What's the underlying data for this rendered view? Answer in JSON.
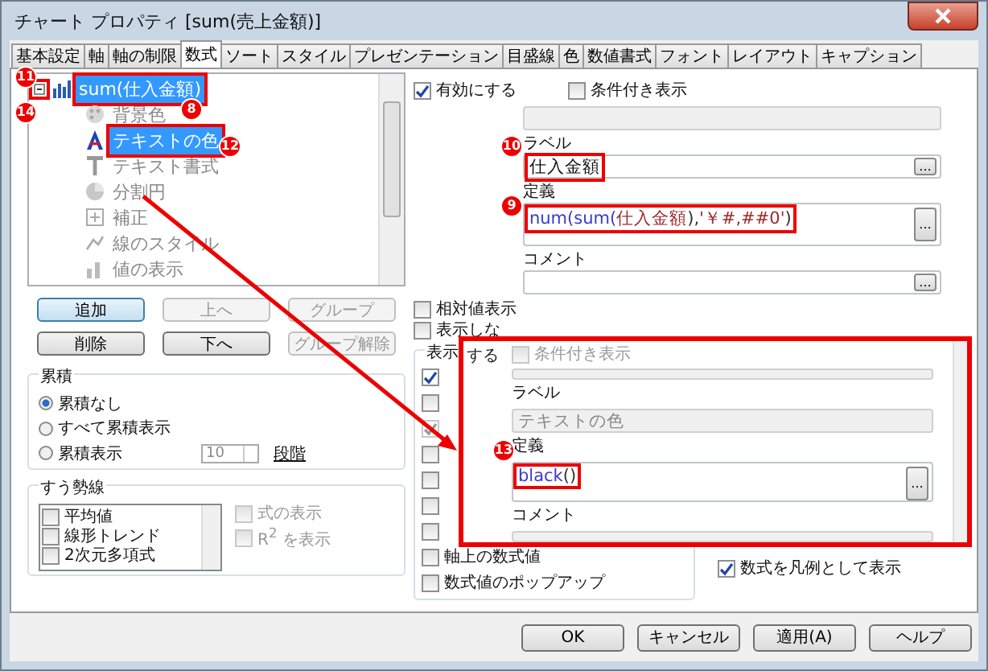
{
  "window": {
    "title": "チャート プロパティ [sum(売上金額)]"
  },
  "tabs": [
    {
      "label": "基本設定",
      "selected": false
    },
    {
      "label": "軸",
      "selected": false
    },
    {
      "label": "軸の制限",
      "selected": false
    },
    {
      "label": "数式",
      "selected": true
    },
    {
      "label": "ソート",
      "selected": false
    },
    {
      "label": "スタイル",
      "selected": false
    },
    {
      "label": "プレゼンテーション",
      "selected": false
    },
    {
      "label": "目盛線",
      "selected": false
    },
    {
      "label": "色",
      "selected": false
    },
    {
      "label": "数値書式",
      "selected": false
    },
    {
      "label": "フォント",
      "selected": false
    },
    {
      "label": "レイアウト",
      "selected": false
    },
    {
      "label": "キャプション",
      "selected": false
    }
  ],
  "tree": [
    {
      "label": "sum(仕入金額)",
      "kind": "bar",
      "selected": true,
      "annotated": true,
      "expander_annotated": true,
      "children": [
        {
          "label": "背景色",
          "kind": "palette",
          "selected": false,
          "dimmed": true,
          "annotated": false
        },
        {
          "label": "テキストの色",
          "kind": "text-color",
          "selected": true,
          "dimmed": false,
          "annotated": true
        },
        {
          "label": "テキスト書式",
          "kind": "text-format",
          "selected": false,
          "dimmed": true,
          "annotated": false
        },
        {
          "label": "分割円",
          "kind": "pie",
          "selected": false,
          "dimmed": true,
          "annotated": false
        },
        {
          "label": "補正",
          "kind": "adjust",
          "selected": false,
          "dimmed": true,
          "annotated": false
        },
        {
          "label": "線のスタイル",
          "kind": "line",
          "selected": false,
          "dimmed": true,
          "annotated": false
        },
        {
          "label": "値の表示",
          "kind": "value",
          "selected": false,
          "dimmed": true,
          "annotated": false
        }
      ]
    }
  ],
  "list_buttons": [
    {
      "label": "追加",
      "disabled": false,
      "default": true
    },
    {
      "label": "上へ",
      "disabled": true,
      "default": false
    },
    {
      "label": "グループ",
      "disabled": true,
      "default": false
    },
    {
      "label": "削除",
      "disabled": false,
      "default": false
    },
    {
      "label": "下へ",
      "disabled": false,
      "default": false
    },
    {
      "label": "グループ解除",
      "disabled": true,
      "default": false
    }
  ],
  "accumulation": {
    "title": "累積",
    "options": [
      {
        "label": "累積なし",
        "selected": true
      },
      {
        "label": "すべて累積表示",
        "selected": false
      },
      {
        "label": "累積表示",
        "selected": false
      }
    ],
    "steps": {
      "value": "10",
      "disabled": true
    },
    "steps_label": "段階"
  },
  "trendlines": {
    "title": "すう勢線",
    "items": [
      {
        "label": "平均値",
        "checked": false
      },
      {
        "label": "線形トレンド",
        "checked": false
      },
      {
        "label": "2次元多項式",
        "checked": false
      }
    ],
    "options": [
      {
        "label": "式の表示",
        "checked": false,
        "disabled": true
      },
      {
        "label": "R$^{2}$ を表示",
        "checked": false,
        "disabled": true
      }
    ]
  },
  "enable": {
    "label": "有効にする",
    "checked": true
  },
  "conditional": {
    "label": "条件付き表示",
    "checked": false,
    "disabled": false
  },
  "label_field": {
    "label": "ラベル",
    "value": "仕入金額",
    "annotated": true,
    "button_label": "..."
  },
  "definition": {
    "label": "定義",
    "annotated": true,
    "button_label": "...",
    "segments": [
      {
        "text": "num(sum(",
        "kind": "function"
      },
      {
        "text": "仕入金額",
        "kind": "field"
      },
      {
        "text": "),",
        "kind": "plain"
      },
      {
        "text": "'￥#,##0'",
        "kind": "string"
      },
      {
        "text": ")",
        "kind": "plain"
      }
    ]
  },
  "comment_field": {
    "label": "コメント",
    "button_label": "..."
  },
  "relative": {
    "label": "相対値表示",
    "checked": false
  },
  "hide": {
    "label": "表示しな",
    "checked": false
  },
  "display": {
    "title": "表示",
    "items": [
      {
        "checked": true,
        "disabled": false
      },
      {
        "checked": false,
        "disabled": false
      },
      {
        "checked": true,
        "disabled": true
      },
      {
        "checked": false,
        "disabled": false
      },
      {
        "checked": false,
        "disabled": false
      },
      {
        "checked": false,
        "disabled": false
      },
      {
        "checked": false,
        "disabled": false
      },
      {
        "label": "軸上の数式値",
        "checked": false,
        "disabled": false
      },
      {
        "label": "数式値のポップアップ",
        "checked": false,
        "disabled": false
      }
    ]
  },
  "legend_option": {
    "label": "数式を凡例として表示",
    "checked": true
  },
  "inset": {
    "wrapped_text": "する",
    "conditional": {
      "label": "条件付き表示",
      "checked": false,
      "disabled": true
    },
    "label_field": {
      "label": "ラベル",
      "value": "テキストの色",
      "disabled": true
    },
    "definition": {
      "label": "定義",
      "annotated": true,
      "button_label": "...",
      "segments": [
        {
          "text": "black",
          "kind": "function"
        },
        {
          "text": "()",
          "kind": "plain"
        }
      ]
    },
    "comment_field": {
      "label": "コメント"
    }
  },
  "callouts": [
    "11",
    "14",
    "8",
    "12",
    "10",
    "9",
    "13"
  ],
  "buttons": [
    "OK",
    "キャンセル",
    "適用(A)",
    "ヘルプ"
  ]
}
